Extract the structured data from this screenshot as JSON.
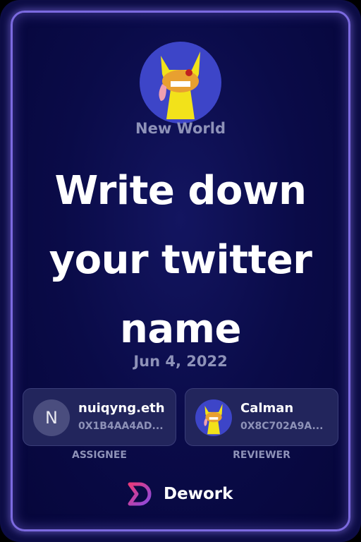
{
  "organization": {
    "name": "New World",
    "avatar_icon": "cartoon-dog-avatar"
  },
  "task": {
    "title": "Write down your twitter name",
    "date": "Jun 4, 2022"
  },
  "assignee": {
    "initial": "N",
    "name": "nuiqyng.eth",
    "address": "0X1B4AA4AD...",
    "role_label": "ASSIGNEE"
  },
  "reviewer": {
    "name": "Calman",
    "address": "0X8C702A9A...",
    "role_label": "REVIEWER",
    "avatar_icon": "cartoon-dog-avatar"
  },
  "brand": {
    "name": "Dework"
  },
  "colors": {
    "border": "#7c6ae0",
    "background": "#0d0d45",
    "muted_text": "#8e92b8"
  }
}
